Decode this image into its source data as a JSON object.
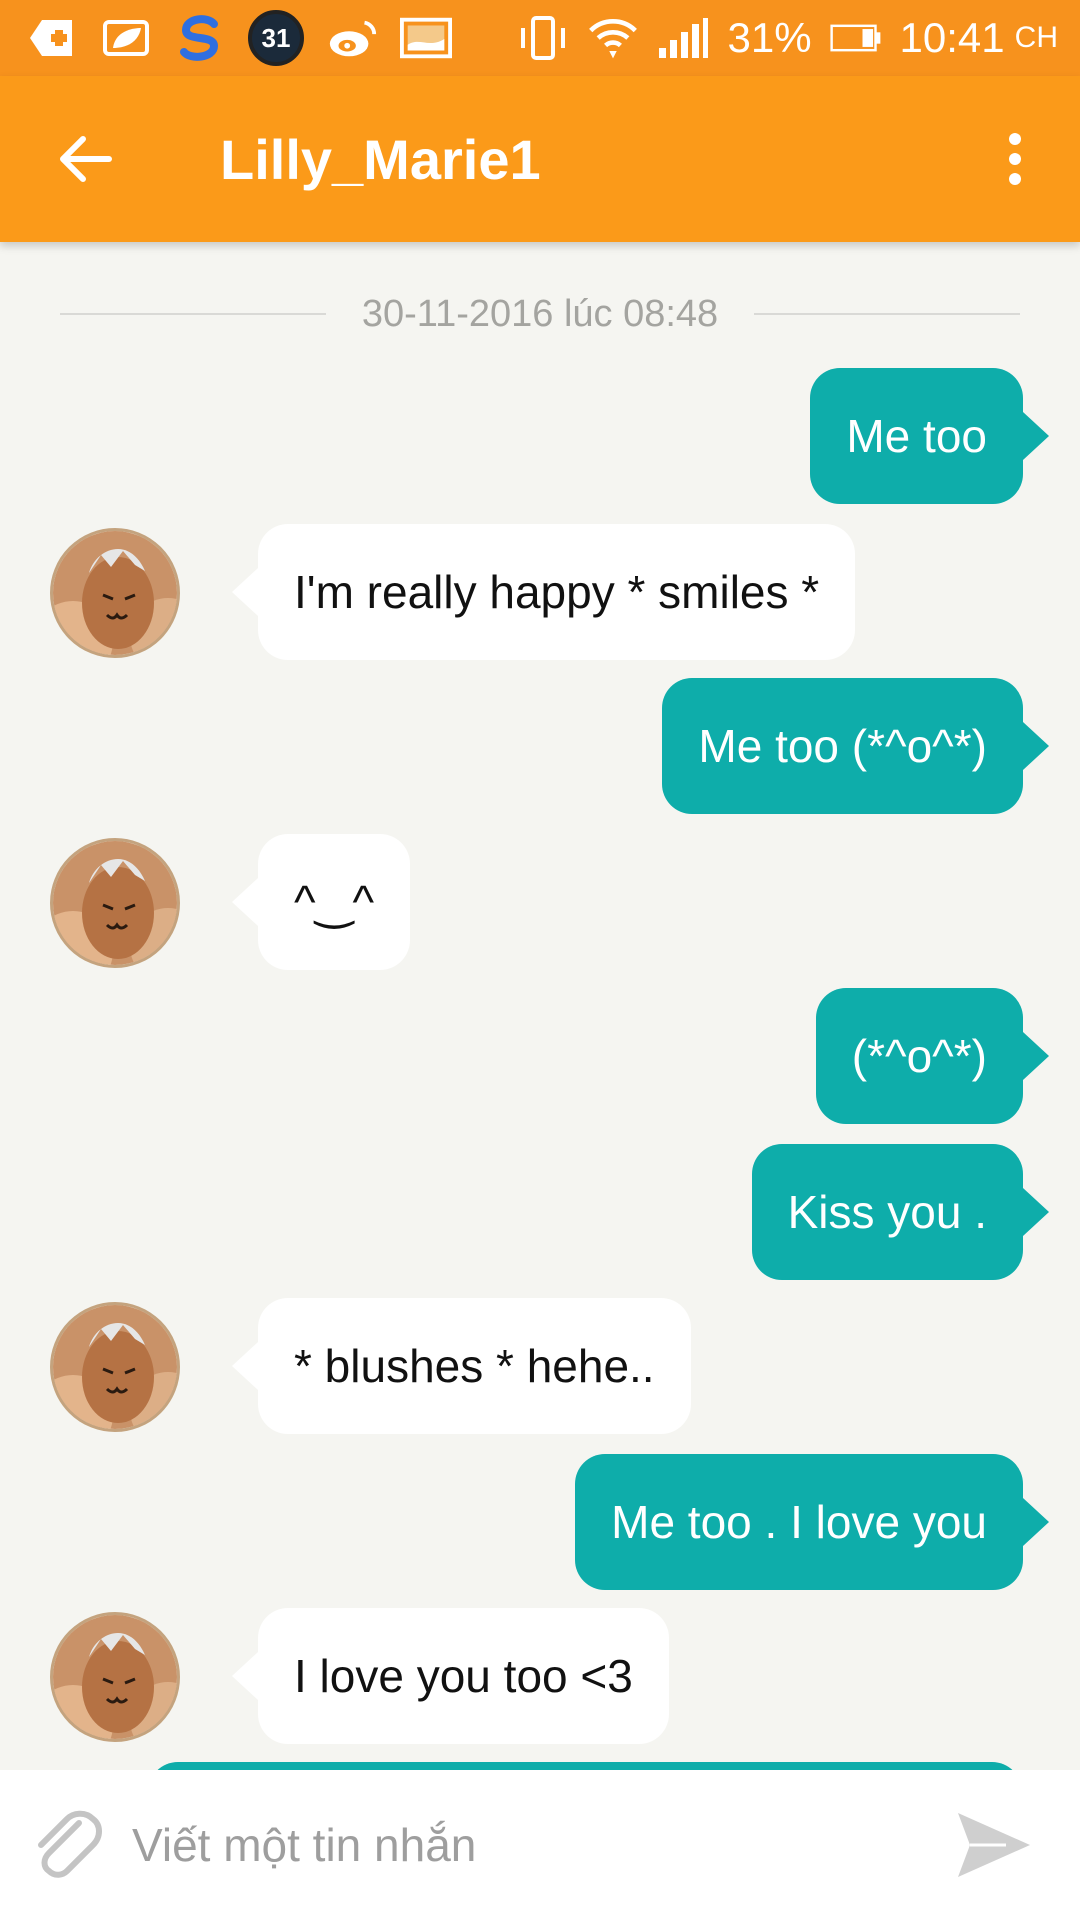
{
  "status_bar": {
    "calendar_badge": "31",
    "battery": "31%",
    "time": "10:41",
    "period": "CH",
    "icons": [
      "add-icon",
      "leaf-icon",
      "s-app-icon",
      "calendar-badge-icon",
      "weibo-icon",
      "image-icon",
      "vibrate-icon",
      "wifi-icon",
      "signal-icon",
      "battery-icon"
    ]
  },
  "header": {
    "title": "Lilly_Marie1",
    "back_icon": "arrow-back-icon",
    "menu_icon": "more-vertical-icon"
  },
  "date_separator": "30-11-2016 lúc 08:48",
  "messages": [
    {
      "direction": "sent",
      "text": "Me too"
    },
    {
      "direction": "received",
      "text": "I'm really happy * smiles *"
    },
    {
      "direction": "sent",
      "text": "Me too (*^o^*)"
    },
    {
      "direction": "received",
      "text": "^‿^"
    },
    {
      "direction": "sent",
      "text": "(*^o^*)"
    },
    {
      "direction": "sent",
      "text": "Kiss you ."
    },
    {
      "direction": "received",
      "text": "* blushes  * hehe.."
    },
    {
      "direction": "sent",
      "text": "Me too . I love you"
    },
    {
      "direction": "received",
      "text": "I love you too <3"
    }
  ],
  "composer": {
    "placeholder": "Viết một tin nhắn",
    "attach_icon": "paperclip-icon",
    "send_icon": "send-icon"
  },
  "colors": {
    "status_bar": "#f7921d",
    "app_bar": "#fb9a19",
    "sent_bubble": "#0eadaa",
    "received_bubble": "#ffffff",
    "background": "#f5f5f1"
  }
}
